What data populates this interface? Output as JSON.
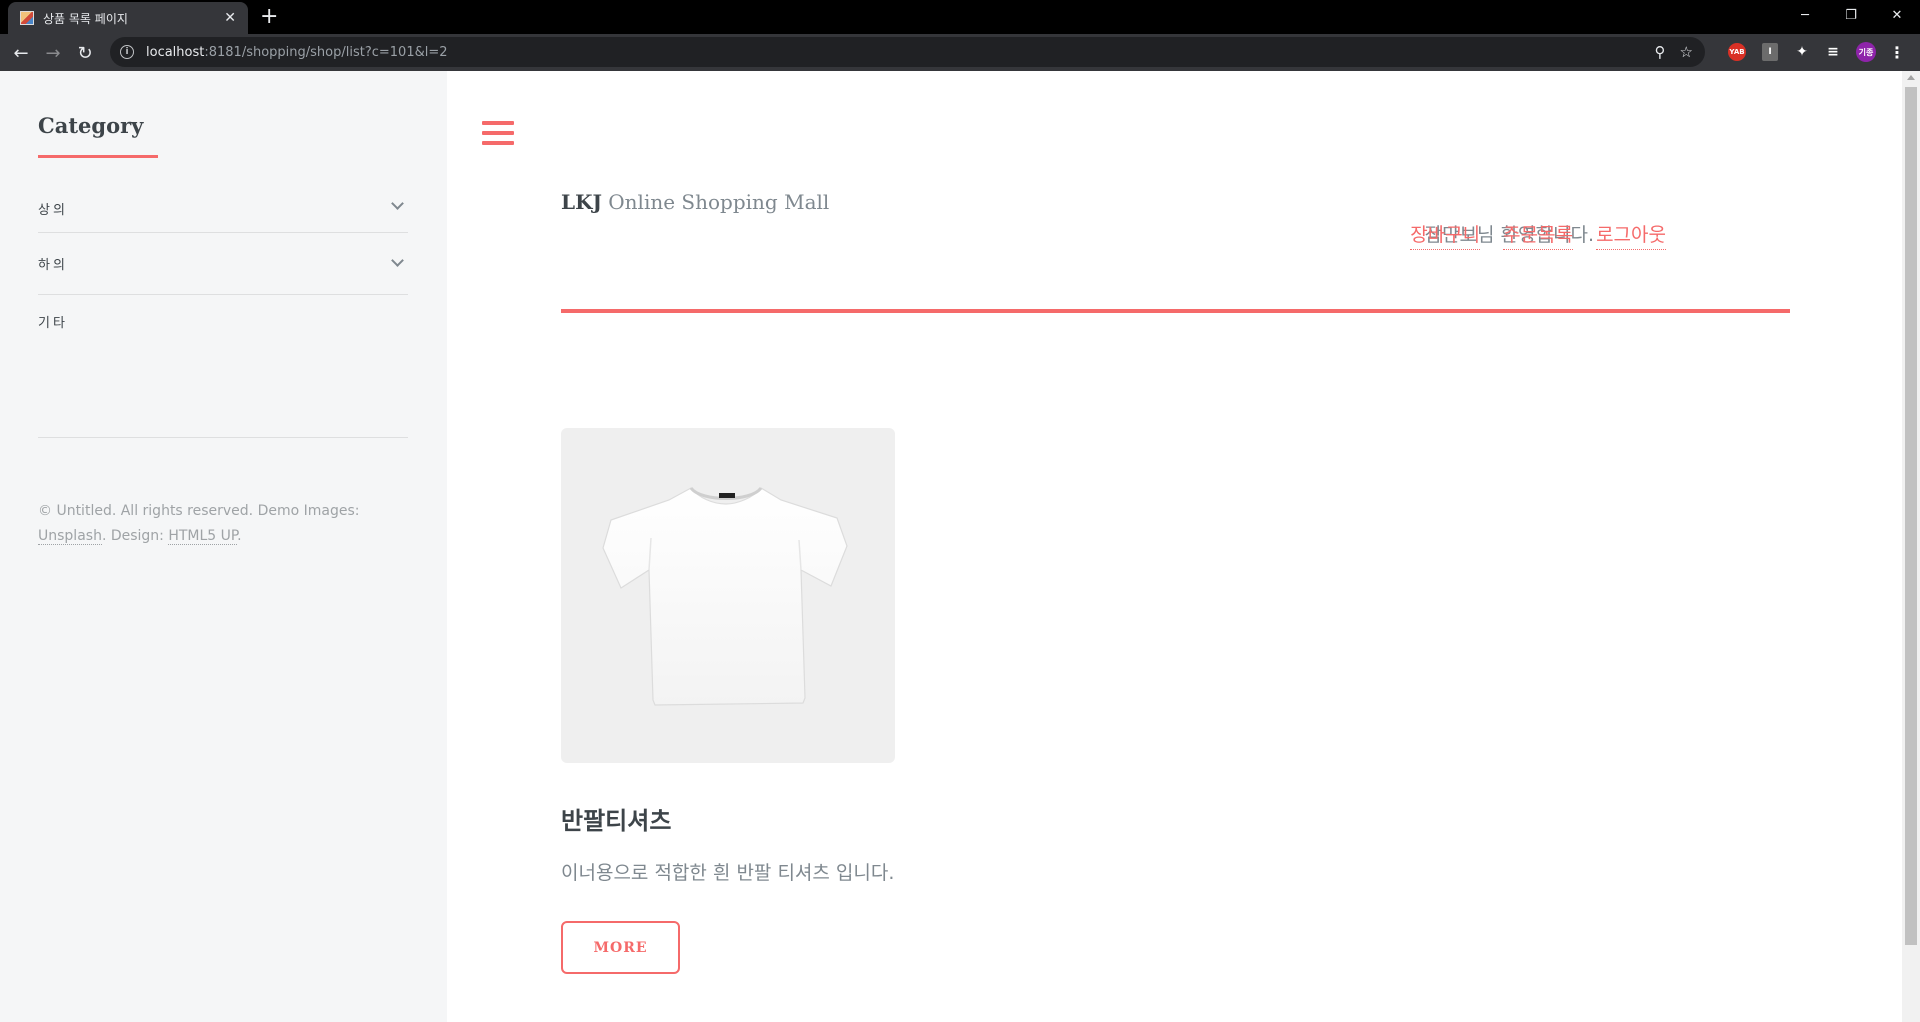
{
  "browser": {
    "tab_title": "상품 목록 페이지",
    "tab_close": "✕",
    "new_tab": "+",
    "url_host": "localhost",
    "url_rest": ":8181/shopping/shop/list?c=101&l=2",
    "window_controls": {
      "minimize": "─",
      "restore": "❐",
      "close": "✕"
    },
    "nav": {
      "back": "←",
      "forward": "→",
      "reload": "↻"
    },
    "omni_icons": {
      "zoom": "⚲",
      "bookmark": "☆"
    },
    "extensions": {
      "yab": "YAB",
      "ext2": "I",
      "puzzle": "✦",
      "media": "≡",
      "profile": "기종",
      "menu": "⋮"
    }
  },
  "sidebar": {
    "title": "Category",
    "items": [
      {
        "label": "상의",
        "has_submenu": true
      },
      {
        "label": "하의",
        "has_submenu": true
      },
      {
        "label": "기타",
        "has_submenu": false
      }
    ],
    "footer": {
      "prefix": "© Untitled. All rights reserved. Demo Images: ",
      "link1": "Unsplash",
      "middle": ". Design: ",
      "link2": "HTML5 UP",
      "suffix": "."
    }
  },
  "header": {
    "logo_strong": "LKJ",
    "logo_rest": " Online Shopping Mall",
    "greeting": "잠만보님 환영합니다.",
    "links": {
      "cart": "장바구니",
      "orders": "주문목록",
      "logout": "로그아웃"
    }
  },
  "products": [
    {
      "name": "반팔티셔츠",
      "description": "이너용으로 적합한 흰 반팔 티셔츠 입니다.",
      "button": "MORE"
    }
  ],
  "colors": {
    "accent": "#f56a6a",
    "text_dark": "#3d4449",
    "text_muted": "#7f888f",
    "sidebar_bg": "#f5f6f7"
  }
}
